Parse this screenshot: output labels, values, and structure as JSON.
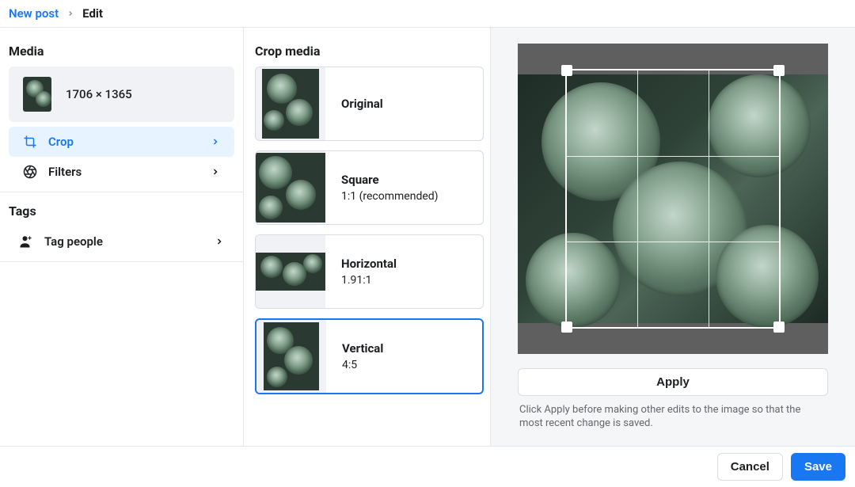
{
  "breadcrumb": {
    "root": "New post",
    "current": "Edit"
  },
  "sidebar": {
    "media_title": "Media",
    "media_size": "1706 × 1365",
    "items": [
      {
        "label": "Crop"
      },
      {
        "label": "Filters"
      }
    ],
    "tags_title": "Tags",
    "tag_people_label": "Tag people"
  },
  "crop_panel": {
    "title": "Crop media",
    "options": [
      {
        "name": "Original",
        "ratio": ""
      },
      {
        "name": "Square",
        "ratio": "1:1 (recommended)"
      },
      {
        "name": "Horizontal",
        "ratio": "1.91:1"
      },
      {
        "name": "Vertical",
        "ratio": "4:5"
      }
    ],
    "selected_index": 3
  },
  "preview": {
    "apply_label": "Apply",
    "hint": "Click Apply before making other edits to the image so that the most recent change is saved."
  },
  "footer": {
    "cancel": "Cancel",
    "save": "Save"
  },
  "colors": {
    "accent": "#1877f2"
  }
}
